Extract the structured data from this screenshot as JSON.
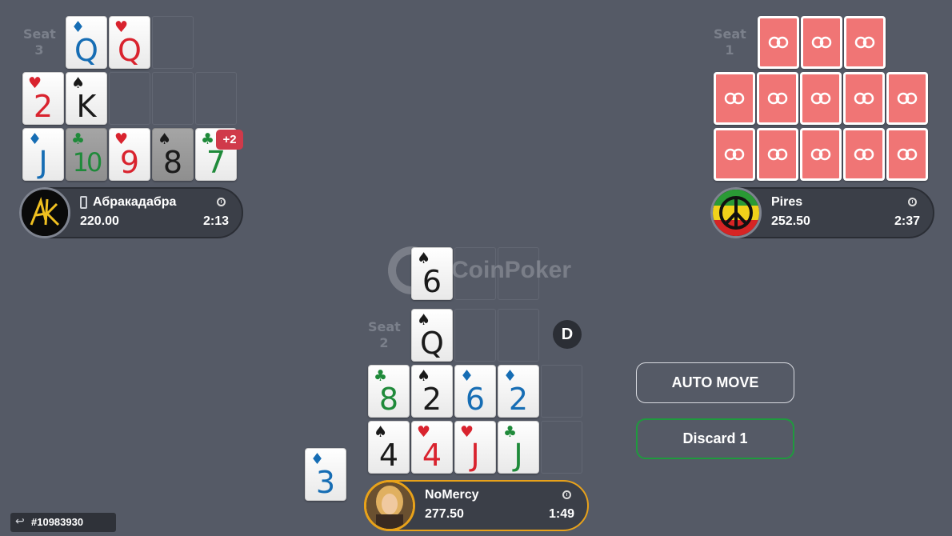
{
  "seats": {
    "seat3": {
      "label": "Seat",
      "number": "3"
    },
    "seat1": {
      "label": "Seat",
      "number": "1"
    },
    "seat2": {
      "label": "Seat",
      "number": "2"
    }
  },
  "players": {
    "p3": {
      "name": "Абракадабра",
      "stack": "220.00",
      "timer": "2:13",
      "badge": "+2",
      "device_icon": "mobile-phone-icon"
    },
    "p1": {
      "name": "Pires",
      "stack": "252.50",
      "timer": "2:37"
    },
    "p2": {
      "name": "NoMercy",
      "stack": "277.50",
      "timer": "1:49"
    }
  },
  "cards": {
    "p3_top": [
      {
        "rank": "Q",
        "suit": "♦",
        "color": "blue"
      },
      {
        "rank": "Q",
        "suit": "♥",
        "color": "red"
      }
    ],
    "p3_mid": [
      {
        "rank": "2",
        "suit": "♥",
        "color": "red"
      },
      {
        "rank": "K",
        "suit": "♠",
        "color": "black"
      }
    ],
    "p3_bot": [
      {
        "rank": "J",
        "suit": "♦",
        "color": "blue"
      },
      {
        "rank": "10",
        "suit": "♣",
        "color": "green",
        "dim": true
      },
      {
        "rank": "9",
        "suit": "♥",
        "color": "red"
      },
      {
        "rank": "8",
        "suit": "♠",
        "color": "black",
        "dim": true
      },
      {
        "rank": "7",
        "suit": "♣",
        "color": "green"
      }
    ],
    "p2_top": [
      {
        "rank": "Q",
        "suit": "♠",
        "color": "black"
      }
    ],
    "p2_mid": [
      {
        "rank": "8",
        "suit": "♣",
        "color": "green"
      },
      {
        "rank": "2",
        "suit": "♠",
        "color": "black"
      },
      {
        "rank": "6",
        "suit": "♦",
        "color": "blue"
      },
      {
        "rank": "2",
        "suit": "♦",
        "color": "blue"
      }
    ],
    "p2_bot": [
      {
        "rank": "4",
        "suit": "♠",
        "color": "black"
      },
      {
        "rank": "4",
        "suit": "♥",
        "color": "red"
      },
      {
        "rank": "J",
        "suit": "♥",
        "color": "red"
      },
      {
        "rank": "J",
        "suit": "♣",
        "color": "green"
      }
    ],
    "center": {
      "rank": "6",
      "suit": "♠",
      "color": "black"
    },
    "hand_card": {
      "rank": "3",
      "suit": "♦",
      "color": "blue"
    }
  },
  "table": {
    "watermark": "CoinPoker",
    "dealer_button": "D",
    "hand_id": "#10983930"
  },
  "buttons": {
    "auto_move": "AUTO MOVE",
    "discard": "Discard 1"
  },
  "colors": {
    "background": "#555a66",
    "card_back": "#f07575",
    "badge": "#d03a4a",
    "active_border": "#e8a21a",
    "discard_border": "#1f9a3e",
    "red": "#d9232e",
    "blue": "#166db4",
    "green": "#1f8a3a",
    "black": "#1a1a1a"
  }
}
